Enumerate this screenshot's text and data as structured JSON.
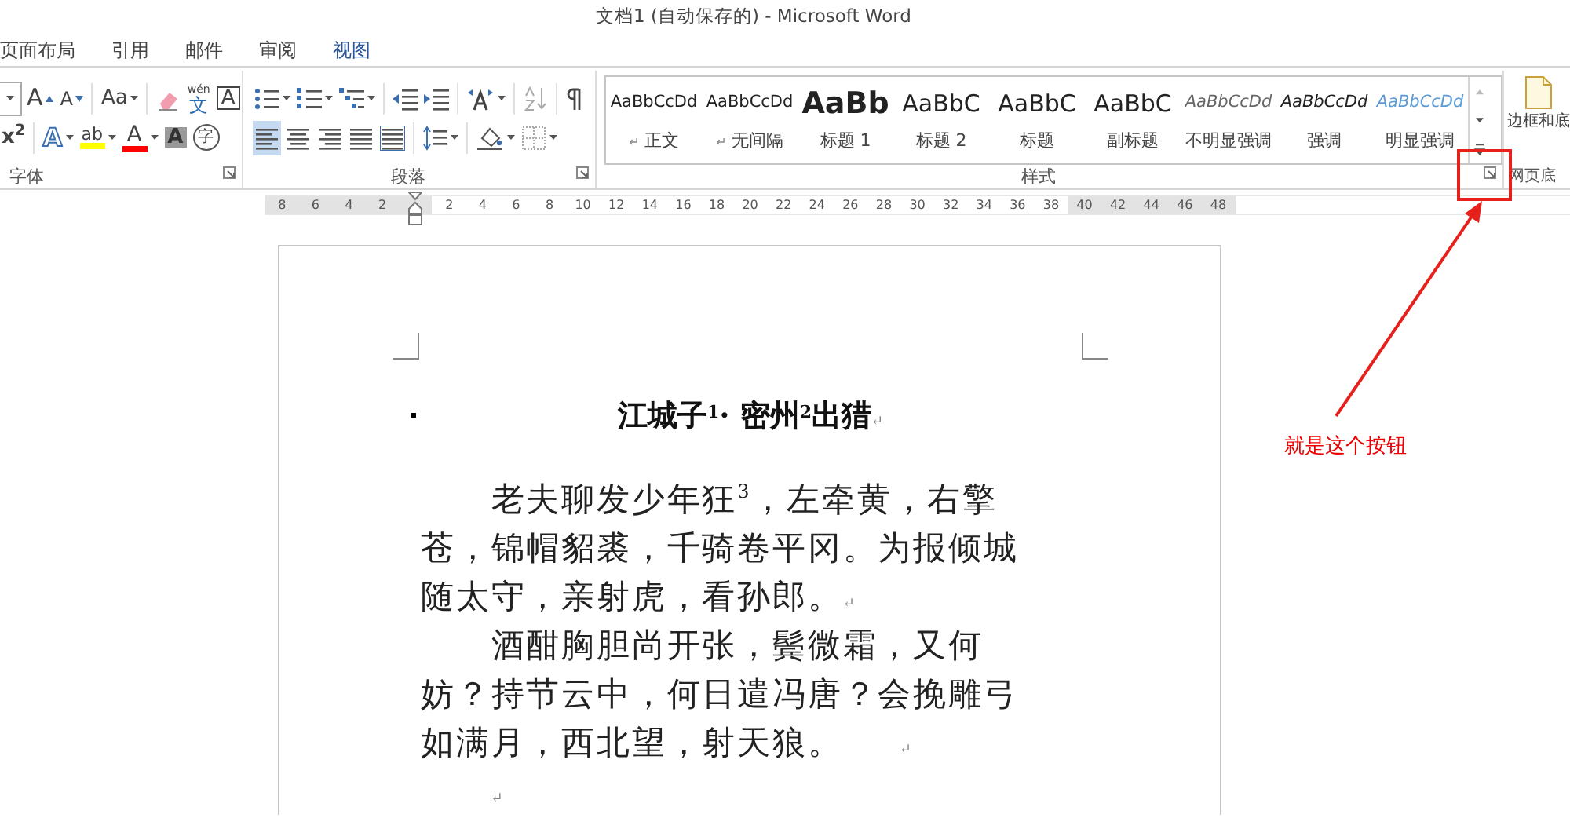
{
  "window": {
    "title": "文档1 (自动保存的) - Microsoft Word"
  },
  "tabs": [
    {
      "label": "页面布局",
      "selected": false
    },
    {
      "label": "引用",
      "selected": false
    },
    {
      "label": "邮件",
      "selected": false
    },
    {
      "label": "审阅",
      "selected": false
    },
    {
      "label": "视图",
      "selected": true
    }
  ],
  "ribbon": {
    "font_group": {
      "label": "字体",
      "top_row": [
        {
          "kind": "size-stub",
          "caret": true
        },
        {
          "kind": "grow-font",
          "text": "A",
          "caret": false
        },
        {
          "kind": "shrink-font",
          "text": "A",
          "caret": false
        },
        {
          "kind": "change-case",
          "text": "Aa",
          "caret": true
        },
        {
          "kind": "clear-format",
          "caret": false
        },
        {
          "kind": "phonetic",
          "text": "文",
          "ruby": "wén",
          "caret": false
        },
        {
          "kind": "char-border",
          "text": "A",
          "caret": false
        }
      ],
      "bottom_row": [
        {
          "kind": "superscript",
          "text": "x$^{2}$",
          "caret": false
        },
        {
          "kind": "text-effect",
          "text": "A",
          "caret": true
        },
        {
          "kind": "highlight",
          "text": "ab",
          "color": "#ffff00",
          "caret": true
        },
        {
          "kind": "font-color",
          "text": "A",
          "color": "#ff0000",
          "caret": true
        },
        {
          "kind": "char-shading",
          "text": "A",
          "caret": false
        },
        {
          "kind": "enclosed",
          "text": "字",
          "caret": false
        }
      ]
    },
    "paragraph_group": {
      "label": "段落",
      "top_row": [
        {
          "kind": "bullets",
          "caret": true
        },
        {
          "kind": "numbering",
          "caret": true
        },
        {
          "kind": "multilevel",
          "caret": true
        },
        {
          "kind": "outdent",
          "caret": false
        },
        {
          "kind": "indent",
          "caret": false
        },
        {
          "kind": "chinese-layout",
          "caret": true
        },
        {
          "kind": "sort",
          "caret": false
        },
        {
          "kind": "show-marks",
          "caret": false
        }
      ],
      "bottom_row": [
        {
          "kind": "align-left",
          "caret": false,
          "selected": true
        },
        {
          "kind": "align-center",
          "caret": false,
          "selected": false
        },
        {
          "kind": "align-right",
          "caret": false,
          "selected": false
        },
        {
          "kind": "justify",
          "caret": false,
          "selected": false
        },
        {
          "kind": "distributed",
          "caret": false,
          "selected": false
        },
        {
          "kind": "line-spacing",
          "caret": true
        },
        {
          "kind": "shading",
          "caret": true
        },
        {
          "kind": "borders",
          "caret": true
        }
      ]
    },
    "styles_group": {
      "label": "样式",
      "styles": [
        {
          "kind": "normal",
          "preview": "AaBbCcDd",
          "name": "正文",
          "para_mark": "↵"
        },
        {
          "kind": "normal",
          "preview": "AaBbCcDd",
          "name": "无间隔",
          "para_mark": "↵"
        },
        {
          "kind": "heading1",
          "preview": "AaBb",
          "name": "标题 1"
        },
        {
          "kind": "heading2",
          "preview": "AaBbC",
          "name": "标题 2"
        },
        {
          "kind": "title",
          "preview": "AaBbC",
          "name": "标题"
        },
        {
          "kind": "subtitle",
          "preview": "AaBbC",
          "name": "副标题"
        },
        {
          "kind": "subtle-emphasis",
          "preview": "AaBbCcDd",
          "name": "不明显强调"
        },
        {
          "kind": "emphasis",
          "preview": "AaBbCcDd",
          "name": "强调"
        },
        {
          "kind": "intense-emphasis",
          "preview": "AaBbCcDd",
          "name": "明显强调"
        }
      ]
    },
    "page_background_group": {
      "label": "网页底",
      "button": "边框和底"
    }
  },
  "ruler": {
    "left_ticks": [
      {
        "label": "8"
      },
      {
        "label": "6"
      },
      {
        "label": "4"
      },
      {
        "label": "2"
      }
    ],
    "right_ticks": [
      {
        "label": "2",
        "margin": false
      },
      {
        "label": "4",
        "margin": false
      },
      {
        "label": "6",
        "margin": false
      },
      {
        "label": "8",
        "margin": false
      },
      {
        "label": "10",
        "margin": false
      },
      {
        "label": "12",
        "margin": false
      },
      {
        "label": "14",
        "margin": false
      },
      {
        "label": "16",
        "margin": false
      },
      {
        "label": "18",
        "margin": false
      },
      {
        "label": "20",
        "margin": false
      },
      {
        "label": "22",
        "margin": false
      },
      {
        "label": "24",
        "margin": false
      },
      {
        "label": "26",
        "margin": false
      },
      {
        "label": "28",
        "margin": false
      },
      {
        "label": "30",
        "margin": false
      },
      {
        "label": "32",
        "margin": false
      },
      {
        "label": "34",
        "margin": false
      },
      {
        "label": "36",
        "margin": false
      },
      {
        "label": "38",
        "margin": false
      },
      {
        "label": "40",
        "margin": true
      },
      {
        "label": "42",
        "margin": true
      },
      {
        "label": "44",
        "margin": true
      },
      {
        "label": "46",
        "margin": true
      },
      {
        "label": "48",
        "margin": true
      }
    ]
  },
  "document": {
    "heading": {
      "text": "江城子$^{1}$· 密州$^{2}$出猎",
      "mark": "↵"
    },
    "paragraphs": [
      {
        "text": "老夫聊发少年狂$^{3}$，左牵黄，右擎苍，锦帽貂裘，千骑卷平冈。为报倾城随太守，亲射虎，看孙郎。",
        "mark": "↵"
      },
      {
        "text": "酒酣胸胆尚开张，鬓微霜，又何妨？持节云中，何日遣冯唐？会挽雕弓如满月，西北望，射天狼。",
        "mark": "↵"
      }
    ],
    "empty_paragraph": {
      "mark": "↵"
    }
  },
  "annotation": {
    "text": "就是这个按钮"
  }
}
